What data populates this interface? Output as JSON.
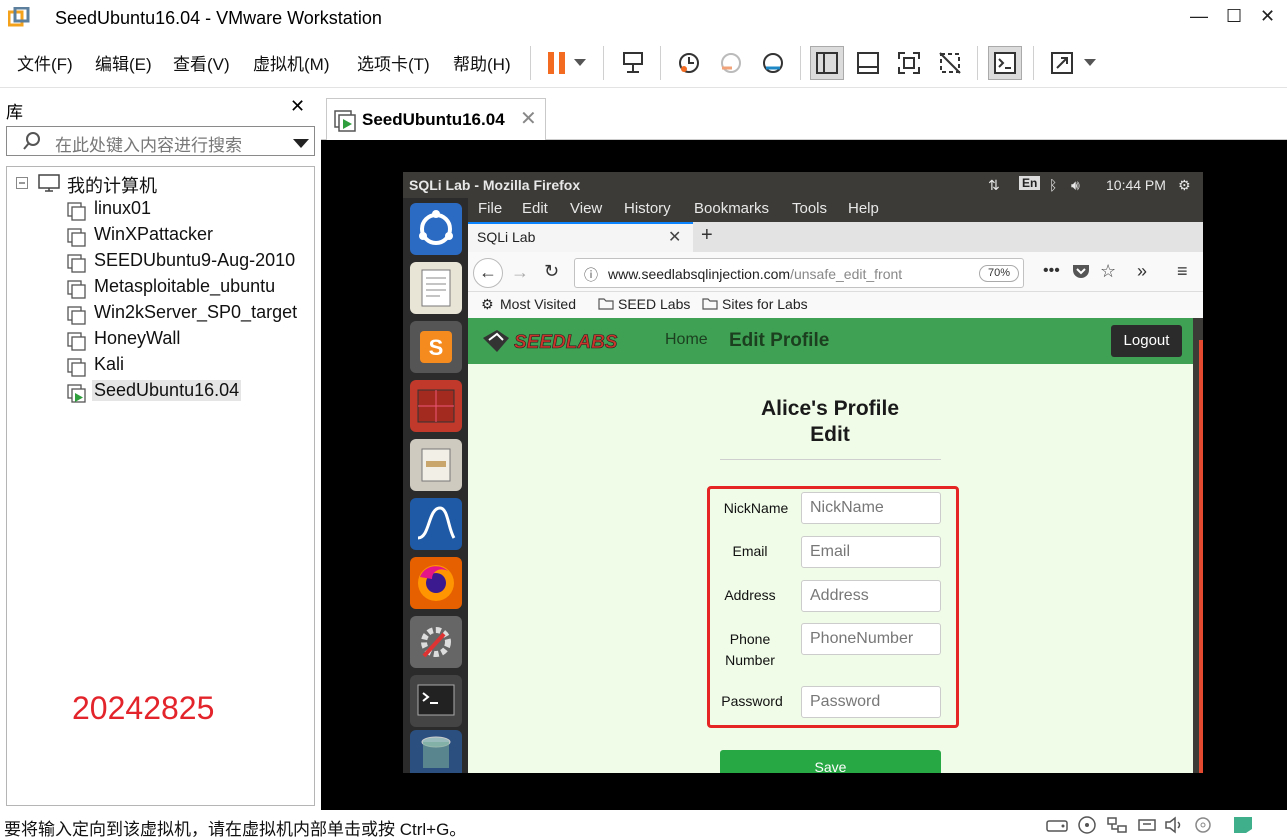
{
  "window": {
    "title": "SeedUbuntu16.04 - VMware Workstation",
    "controls": [
      "—",
      "☐",
      "✕"
    ]
  },
  "menu": [
    "文件(F)",
    "编辑(E)",
    "查看(V)",
    "虚拟机(M)",
    "选项卡(T)",
    "帮助(H)"
  ],
  "library": {
    "title": "库",
    "search_placeholder": "在此处键入内容进行搜索",
    "root": "我的计算机",
    "vms": [
      "linux01",
      "WinXPattacker",
      "SEEDUbuntu9-Aug-2010",
      "Metasploitable_ubuntu",
      "Win2kServer_SP0_target",
      "HoneyWall",
      "Kali",
      "SeedUbuntu16.04"
    ],
    "selected": "SeedUbuntu16.04",
    "note": "20242825"
  },
  "vm_tab": {
    "label": "SeedUbuntu16.04"
  },
  "guest": {
    "window_title": "SQLi Lab - Mozilla Firefox",
    "tray": {
      "lang": "En",
      "time": "10:44 PM"
    },
    "firefox": {
      "menu": [
        "File",
        "Edit",
        "View",
        "History",
        "Bookmarks",
        "Tools",
        "Help"
      ],
      "tab": "SQLi Lab",
      "url_host": "www.seedlabsqlinjection.com",
      "url_path": "/unsafe_edit_front",
      "zoom": "70%",
      "bookmarks": [
        "Most Visited",
        "SEED Labs",
        "Sites for Labs"
      ]
    },
    "page": {
      "logo": "SEEDLABS",
      "nav_home": "Home",
      "nav_edit": "Edit Profile",
      "logout": "Logout",
      "title_line1": "Alice's Profile",
      "title_line2": "Edit",
      "fields": [
        {
          "label": "NickName",
          "placeholder": "NickName"
        },
        {
          "label": "Email",
          "placeholder": "Email"
        },
        {
          "label": "Address",
          "placeholder": "Address"
        },
        {
          "label": "Phone Number",
          "placeholder": "PhoneNumber"
        },
        {
          "label": "Password",
          "placeholder": "Password"
        }
      ],
      "save": "Save"
    }
  },
  "status": {
    "text": "要将输入定向到该虚拟机，请在虚拟机内部单击或按 Ctrl+G。"
  },
  "colors": {
    "nav_green": "#3fa154",
    "save_green": "#28a745",
    "highlight_red": "#e52424",
    "page_bg": "#f0fce8"
  }
}
